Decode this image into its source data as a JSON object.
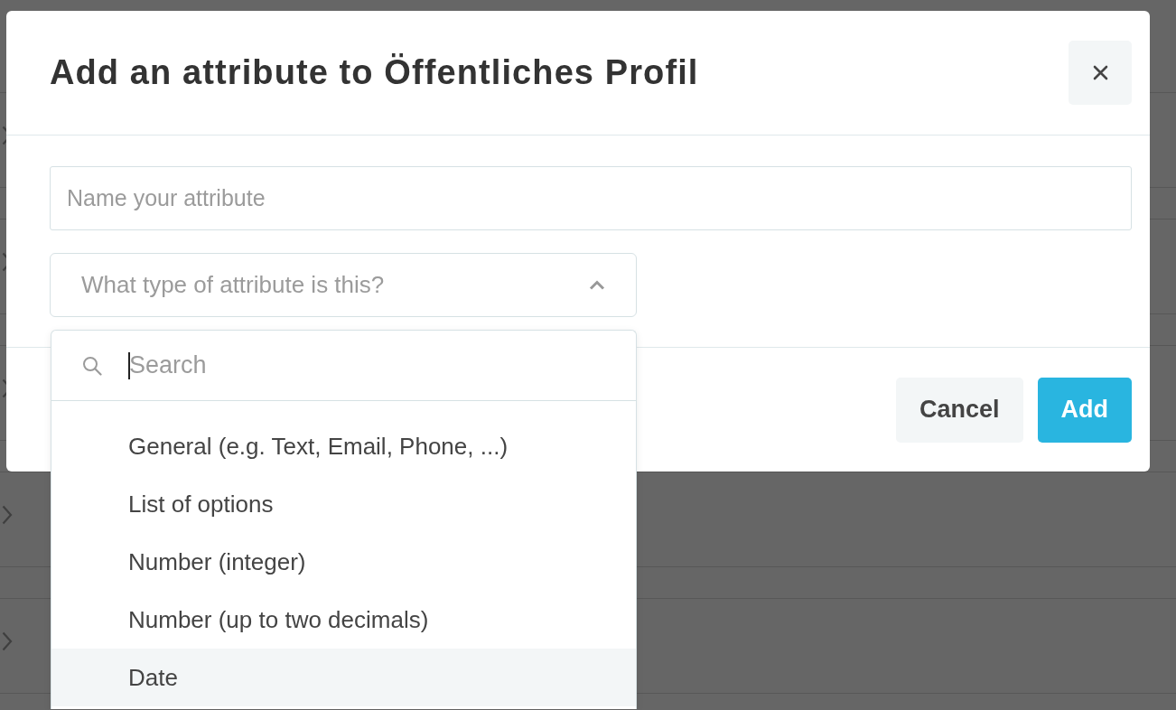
{
  "background_list": {
    "rows": [
      {
        "expanded": false
      },
      {
        "expanded": false
      },
      {
        "expanded": false
      },
      {
        "expanded": false
      },
      {
        "expanded": false
      }
    ]
  },
  "dialog": {
    "title": "Add an attribute to Öffentliches Profil"
  },
  "name_field": {
    "placeholder": "Name your attribute"
  },
  "type_select": {
    "placeholder": "What type of attribute is this?",
    "expanded": true,
    "search": {
      "placeholder": "Search",
      "focused": true
    },
    "options": [
      {
        "label": "General (e.g. Text, Email, Phone, ...)",
        "highlighted": false
      },
      {
        "label": "List of options",
        "highlighted": false
      },
      {
        "label": "Number (integer)",
        "highlighted": false
      },
      {
        "label": "Number (up to two decimals)",
        "highlighted": false
      },
      {
        "label": "Date",
        "highlighted": true
      }
    ]
  },
  "buttons": [
    {
      "label": "Cancel",
      "kind": "secondary"
    },
    {
      "label": "Add",
      "kind": "primary"
    }
  ]
}
